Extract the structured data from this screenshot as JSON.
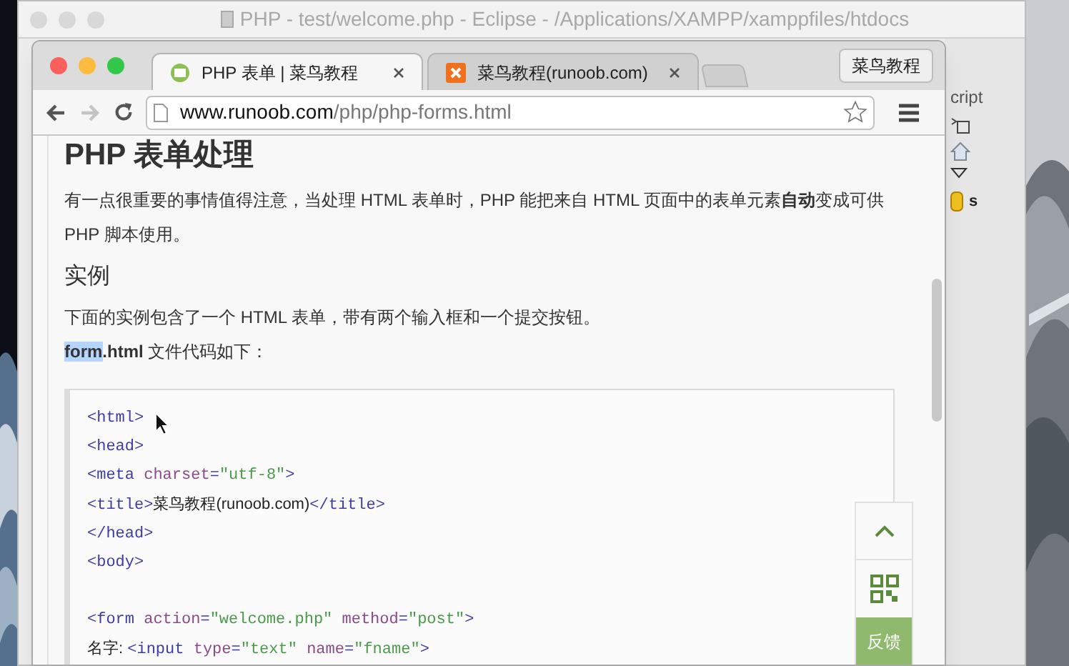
{
  "eclipse": {
    "title": "PHP - test/welcome.php - Eclipse - /Applications/XAMPP/xamppfiles/htdocs",
    "side_label": "cript",
    "tree_item": "s"
  },
  "browser": {
    "tabs": [
      {
        "label": "PHP 表单 | 菜鸟教程",
        "selected": true,
        "kind": "page"
      },
      {
        "label": "菜鸟教程(runoob.com)",
        "selected": false,
        "kind": "site"
      }
    ],
    "profile": "菜鸟教程",
    "back_disabled": false,
    "forward_disabled": true,
    "url": {
      "host": "www.runoob.com",
      "path": "/php/php-forms.html"
    }
  },
  "page": {
    "heading": "PHP 表单处理",
    "intro": "有一点很重要的事情值得注意，当处理 HTML 表单时，PHP 能把来自 HTML 页面中的表单元素**自动**变成可供PHP 脚本使用。",
    "subheading": "实例",
    "example_text": "下面的实例包含了一个 HTML 表单，带有两个输入框和一个提交按钮。",
    "file_line": [
      {
        "text": "form",
        "bold": true,
        "highlighted": true
      },
      {
        "text": ".html",
        "bold": true,
        "highlighted": false
      },
      {
        "text": " 文件代码如下：",
        "bold": false,
        "highlighted": false
      }
    ],
    "code": [
      {
        "kind": "code",
        "tokens": [
          {
            "kind": "tag",
            "text": "<html>"
          }
        ]
      },
      {
        "kind": "code",
        "tokens": [
          {
            "kind": "tag",
            "text": "<head>"
          }
        ]
      },
      {
        "kind": "code",
        "tokens": [
          {
            "kind": "tag",
            "text": "<meta "
          },
          {
            "kind": "attr",
            "text": "charset"
          },
          {
            "kind": "tag",
            "text": "="
          },
          {
            "kind": "value",
            "text": "\"utf-8\""
          },
          {
            "kind": "tag",
            "text": ">"
          }
        ]
      },
      {
        "kind": "code",
        "tokens": [
          {
            "kind": "tag",
            "text": "<title>"
          },
          {
            "kind": "text",
            "text": "菜鸟教程(runoob.com)"
          },
          {
            "kind": "tag",
            "text": "</title>"
          }
        ]
      },
      {
        "kind": "code",
        "tokens": [
          {
            "kind": "tag",
            "text": "</head>"
          }
        ]
      },
      {
        "kind": "code",
        "tokens": [
          {
            "kind": "tag",
            "text": "<body>"
          }
        ]
      },
      {
        "kind": "blank"
      },
      {
        "kind": "code",
        "tokens": [
          {
            "kind": "tag",
            "text": "<form "
          },
          {
            "kind": "attr",
            "text": "action"
          },
          {
            "kind": "tag",
            "text": "="
          },
          {
            "kind": "value",
            "text": "\"welcome.php\" "
          },
          {
            "kind": "attr",
            "text": "method"
          },
          {
            "kind": "tag",
            "text": "="
          },
          {
            "kind": "value",
            "text": "\"post\""
          },
          {
            "kind": "tag",
            "text": ">"
          }
        ]
      },
      {
        "kind": "code",
        "tokens": [
          {
            "kind": "text",
            "text": "名字: "
          },
          {
            "kind": "tag",
            "text": "<input "
          },
          {
            "kind": "attr",
            "text": "type"
          },
          {
            "kind": "tag",
            "text": "="
          },
          {
            "kind": "value",
            "text": "\"text\" "
          },
          {
            "kind": "attr",
            "text": "name"
          },
          {
            "kind": "tag",
            "text": "="
          },
          {
            "kind": "value",
            "text": "\"fname\""
          },
          {
            "kind": "tag",
            "text": ">"
          }
        ]
      }
    ],
    "feedback": "反馈"
  }
}
